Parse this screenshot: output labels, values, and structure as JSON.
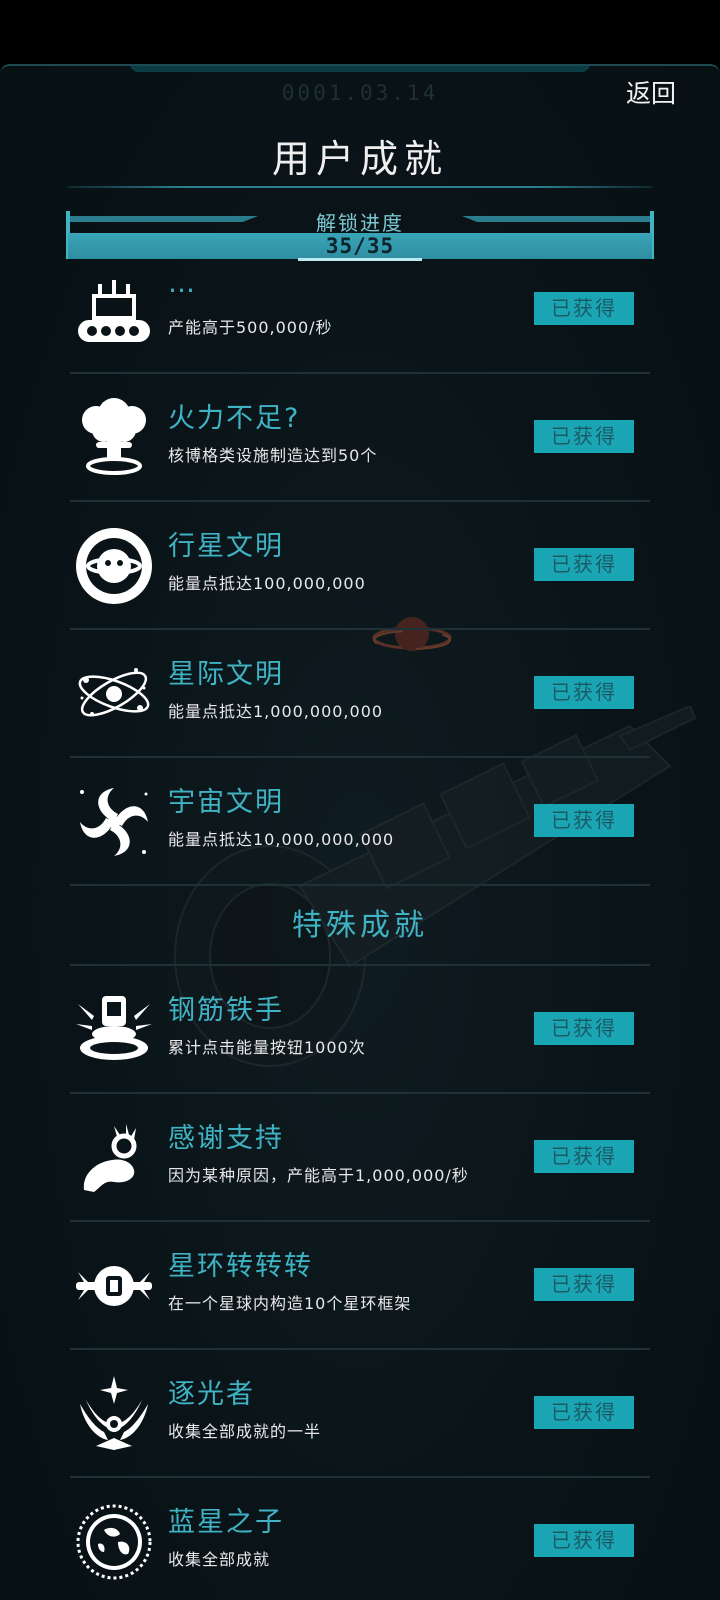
{
  "header": {
    "date": "0001.03.14",
    "back_label": "返回",
    "title": "用户成就"
  },
  "progress": {
    "label": "解锁进度",
    "value_text": "35/35",
    "fraction": 1.0
  },
  "colors": {
    "accent": "#3fb3c4",
    "badge_bg": "#1aa5b4",
    "badge_text": "#1c5b65",
    "panel_bg": "#0a1418"
  },
  "achievements": [
    {
      "icon": "factory-robot-icon",
      "name": "…",
      "desc": "产能高于500,000/秒",
      "status": "已获得"
    },
    {
      "icon": "mushroom-cloud-icon",
      "name": "火力不足?",
      "desc": "核博格类设施制造达到50个",
      "status": "已获得"
    },
    {
      "icon": "planet-face-icon",
      "name": "行星文明",
      "desc": "能量点抵达100,000,000",
      "status": "已获得"
    },
    {
      "icon": "orbit-atom-icon",
      "name": "星际文明",
      "desc": "能量点抵达1,000,000,000",
      "status": "已获得"
    },
    {
      "icon": "galaxy-spiral-icon",
      "name": "宇宙文明",
      "desc": "能量点抵达10,000,000,000",
      "status": "已获得"
    }
  ],
  "special_section": {
    "title": "特殊成就",
    "items": [
      {
        "icon": "pressing-button-icon",
        "name": "钢筋铁手",
        "desc": "累计点击能量按钮1000次",
        "status": "已获得"
      },
      {
        "icon": "ok-hand-icon",
        "name": "感谢支持",
        "desc": "因为某种原因，产能高于1,000,000/秒",
        "status": "已获得"
      },
      {
        "icon": "ring-station-icon",
        "name": "星环转转转",
        "desc": "在一个星球内构造10个星环框架",
        "status": "已获得"
      },
      {
        "icon": "winged-star-icon",
        "name": "逐光者",
        "desc": "收集全部成就的一半",
        "status": "已获得"
      },
      {
        "icon": "blue-planet-emblem-icon",
        "name": "蓝星之子",
        "desc": "收集全部成就",
        "status": "已获得"
      }
    ]
  }
}
